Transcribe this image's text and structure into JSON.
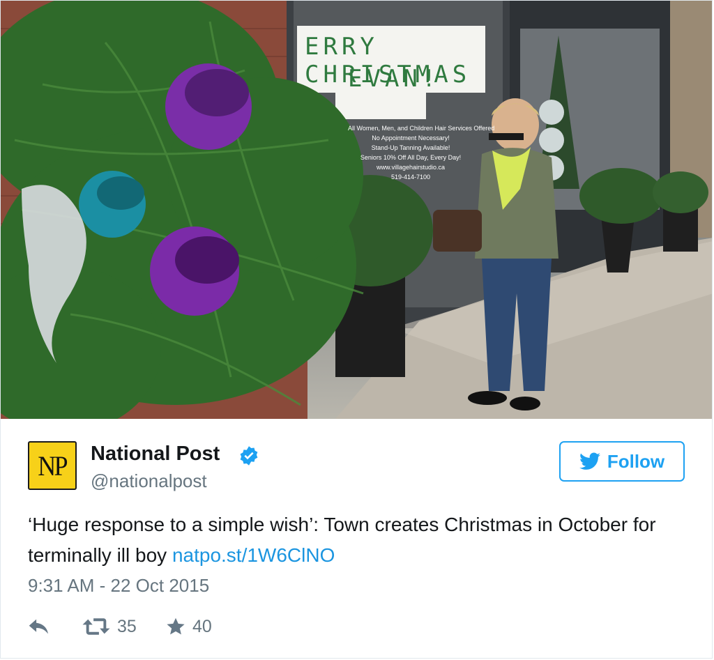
{
  "photo": {
    "banner_line1": "ERRY CHRISTMAS",
    "banner_line2": "EVAN!",
    "shop_notes": [
      "All Women, Men, and Children Hair Services Offered",
      "No Appointment Necessary!",
      "Stand-Up Tanning Available!",
      "Seniors 10% Off All Day, Every Day!",
      "www.villagehairstudio.ca",
      "519-414-7100"
    ]
  },
  "account": {
    "logo_text": "NP",
    "name": "National Post",
    "handle": "@nationalpost",
    "verified": true
  },
  "follow_label": "Follow",
  "tweet": {
    "text": "‘Huge response to a simple wish’: Town creates Christmas in October for terminally ill boy ",
    "link": "natpo.st/1W6ClNO",
    "timestamp": "9:31 AM - 22 Oct 2015"
  },
  "actions": {
    "retweets": "35",
    "likes": "40"
  },
  "colors": {
    "accent": "#1da1f2",
    "link": "#1b95e0",
    "text": "#14171a",
    "muted": "#66757f",
    "logo_bg": "#f7d119"
  }
}
